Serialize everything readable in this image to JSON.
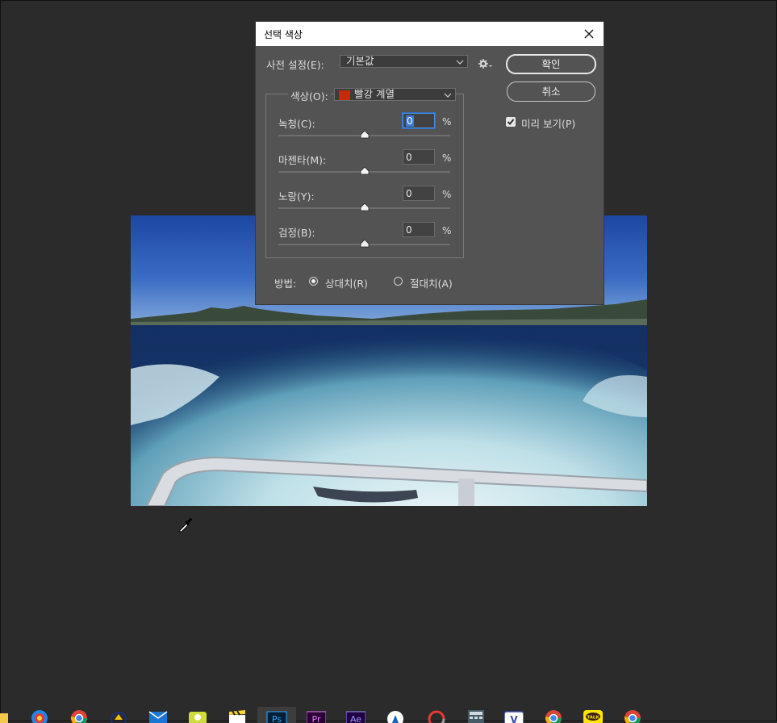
{
  "dialog": {
    "title": "선택 색상",
    "preset_label": "사전 설정(E):",
    "preset_value": "기본값",
    "ok_label": "확인",
    "cancel_label": "취소",
    "preview_label": "미리 보기(P)",
    "preview_checked": true,
    "colors_label": "색상(O):",
    "colors_value": "빨강 계열",
    "colors_swatch": "#c72a08",
    "sliders": [
      {
        "label": "녹청(C):",
        "value": "0",
        "unit": "%",
        "level": 0
      },
      {
        "label": "마젠타(M):",
        "value": "0",
        "unit": "%",
        "level": 0
      },
      {
        "label": "노랑(Y):",
        "value": "0",
        "unit": "%",
        "level": 0
      },
      {
        "label": "검정(B):",
        "value": "0",
        "unit": "%",
        "level": 0
      }
    ],
    "method_label": "방법:",
    "method_options": [
      {
        "label": "상대치(R)",
        "selected": true
      },
      {
        "label": "절대치(A)",
        "selected": false
      }
    ]
  },
  "taskbar": {
    "apps": [
      {
        "name": "file-explorer-icon"
      },
      {
        "name": "colorful-app-icon"
      },
      {
        "name": "chrome-icon"
      },
      {
        "name": "app-icon"
      },
      {
        "name": "mail-icon"
      },
      {
        "name": "image-viewer-icon"
      },
      {
        "name": "video-editor-icon"
      },
      {
        "name": "photoshop-icon",
        "label": "Ps",
        "active": true
      },
      {
        "name": "premiere-icon",
        "label": "Pr"
      },
      {
        "name": "after-effects-icon",
        "label": "Ae"
      },
      {
        "name": "app-icon"
      },
      {
        "name": "davinci-icon"
      },
      {
        "name": "calculator-icon"
      },
      {
        "name": "app-icon",
        "label": "V"
      },
      {
        "name": "chrome-icon"
      },
      {
        "name": "kakaotalk-icon",
        "label": "TALK"
      },
      {
        "name": "chrome-icon"
      }
    ]
  }
}
